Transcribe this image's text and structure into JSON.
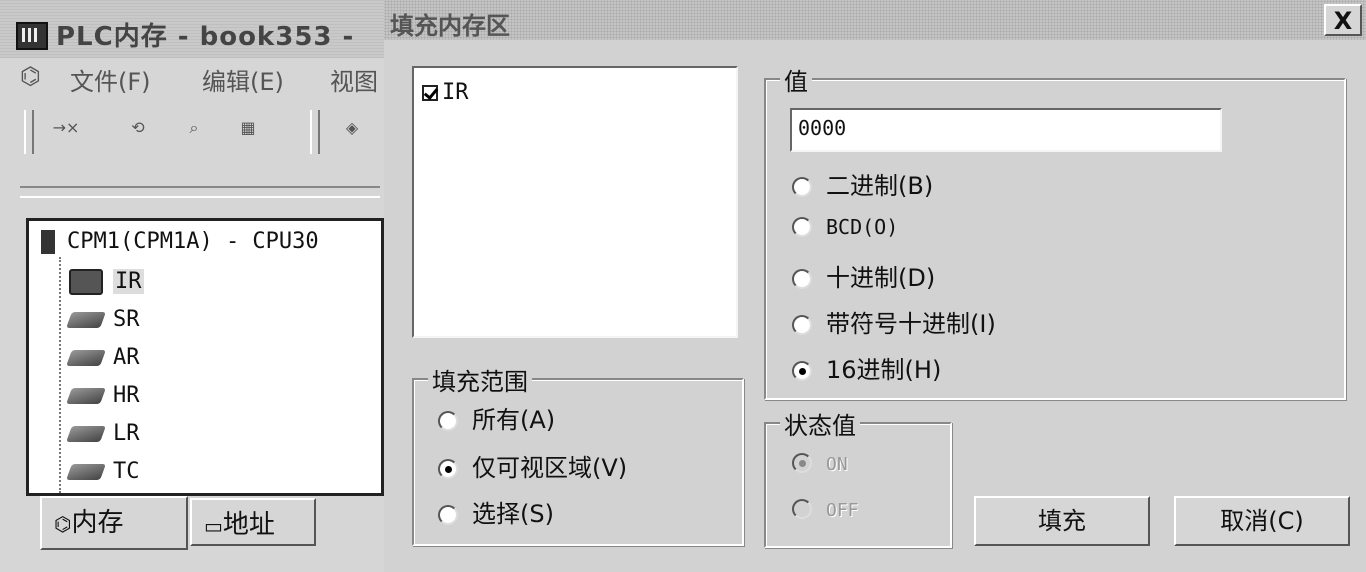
{
  "background_window": {
    "title": "PLC内存 - book353 -",
    "menu": [
      "文件(F)",
      "编辑(E)",
      "视图"
    ],
    "toolbar_icons": [
      "clear-icon",
      "watch-icon",
      "find-icon",
      "address-icon",
      "fill-icon"
    ],
    "tree": {
      "root": "CPM1(CPM1A) - CPU30",
      "items": [
        "IR",
        "SR",
        "AR",
        "HR",
        "LR",
        "TC"
      ]
    },
    "tabs": [
      "内存",
      "地址"
    ]
  },
  "dialog": {
    "title": "填充内存区",
    "close_label": "X",
    "memory_list": [
      {
        "label": "IR",
        "checked": true
      }
    ],
    "value_group": {
      "label": "值",
      "value": "0000",
      "options": [
        "二进制(B)",
        "BCD(O)",
        "十进制(D)",
        "带符号十进制(I)",
        "16进制(H)"
      ],
      "selected": "16进制(H)"
    },
    "range_group": {
      "label": "填充范围",
      "options": [
        "所有(A)",
        "仅可视区域(V)",
        "选择(S)"
      ],
      "selected": "仅可视区域(V)"
    },
    "state_group": {
      "label": "状态值",
      "options": [
        "ON",
        "OFF"
      ],
      "selected": "ON",
      "disabled": true
    },
    "buttons": {
      "fill": "填充",
      "cancel": "取消(C)"
    }
  }
}
